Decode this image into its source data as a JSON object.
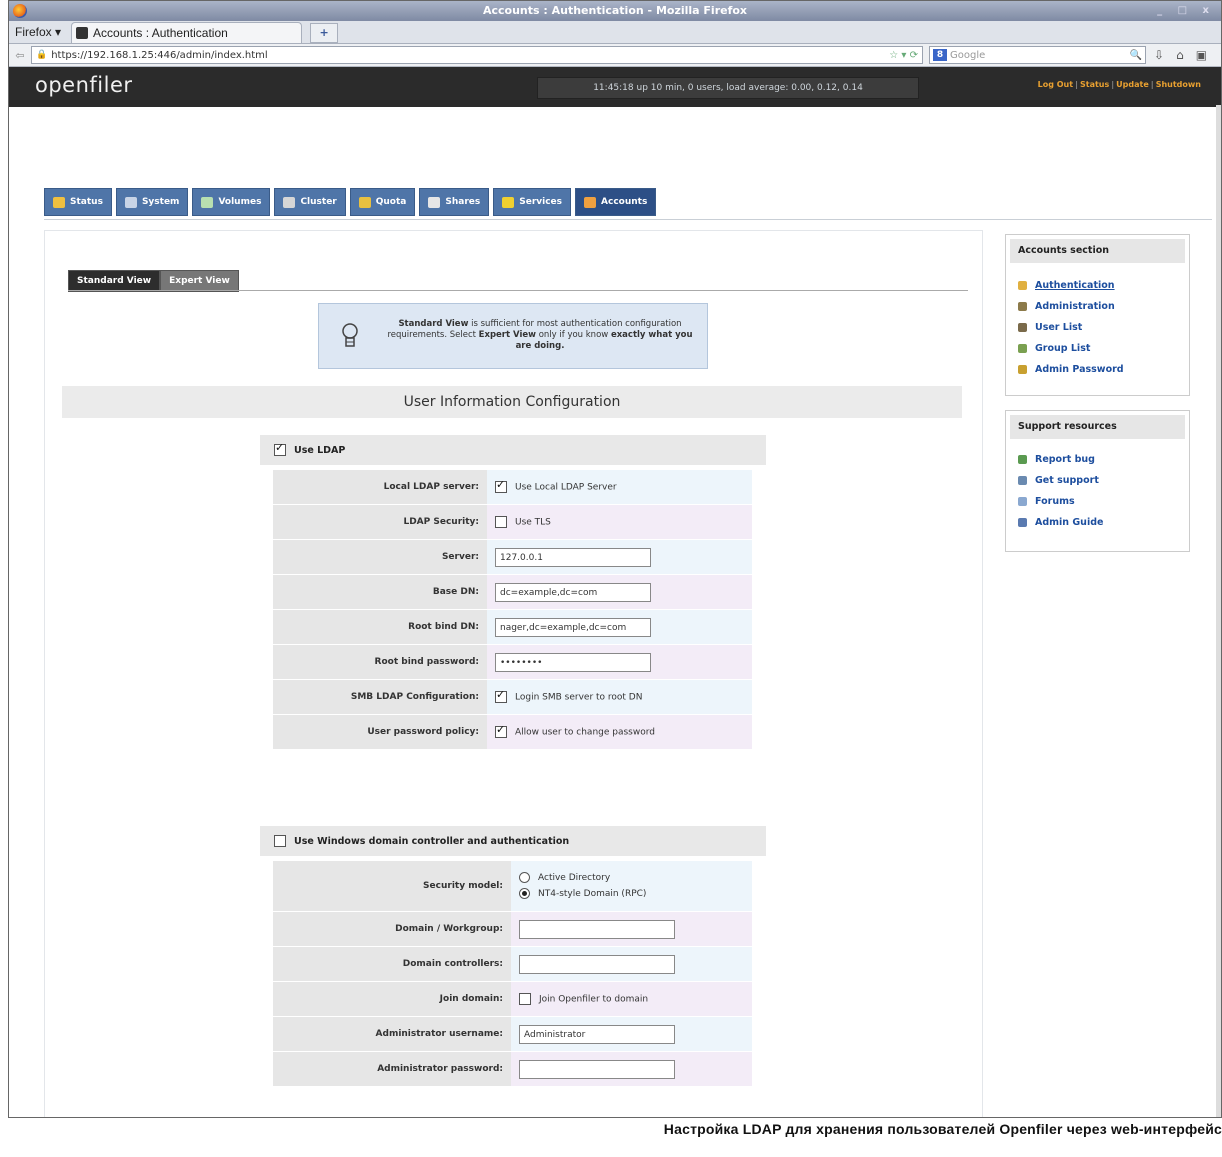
{
  "browser": {
    "window_title": "Accounts : Authentication - Mozilla Firefox",
    "menu_label": "Firefox",
    "tab_title": "Accounts : Authentication",
    "new_tab": "+",
    "url": "https://192.168.1.25:446/admin/index.html",
    "search_placeholder": "Google",
    "search_engine": "8",
    "window_buttons": "_ □ x"
  },
  "header": {
    "logo": "openfiler",
    "status_line": "11:45:18 up 10 min, 0 users, load average: 0.00, 0.12, 0.14",
    "links": [
      "Log Out",
      "Status",
      "Update",
      "Shutdown"
    ]
  },
  "nav_tabs": [
    {
      "label": "Status",
      "icon": "status-icon",
      "color": "#f0c040"
    },
    {
      "label": "System",
      "icon": "system-icon",
      "color": "#c8d4e6"
    },
    {
      "label": "Volumes",
      "icon": "volumes-icon",
      "color": "#b8e0b0"
    },
    {
      "label": "Cluster",
      "icon": "cluster-icon",
      "color": "#d6d6d6"
    },
    {
      "label": "Quota",
      "icon": "quota-icon",
      "color": "#e8c040"
    },
    {
      "label": "Shares",
      "icon": "shares-icon",
      "color": "#e6e6e6"
    },
    {
      "label": "Services",
      "icon": "services-icon",
      "color": "#f0d030"
    },
    {
      "label": "Accounts",
      "icon": "accounts-icon",
      "color": "#f0a040"
    }
  ],
  "view_tabs": {
    "standard": "Standard View",
    "expert": "Expert View"
  },
  "tip": {
    "bold1": "Standard View",
    "text1": " is sufficient for most authentication configuration requirements. Select ",
    "bold2": "Expert View",
    "text2": " only if you know ",
    "bold3": "exactly what you are doing."
  },
  "section_title": "User Information Configuration",
  "ldap": {
    "header": "Use LDAP",
    "checked": true,
    "rows": [
      {
        "label": "Local LDAP server:",
        "type": "checkbox",
        "checked": true,
        "text": "Use Local LDAP Server"
      },
      {
        "label": "LDAP Security:",
        "type": "checkbox",
        "checked": false,
        "text": "Use TLS"
      },
      {
        "label": "Server:",
        "type": "input",
        "value": "127.0.0.1"
      },
      {
        "label": "Base DN:",
        "type": "input",
        "value": "dc=example,dc=com"
      },
      {
        "label": "Root bind DN:",
        "type": "input",
        "value": "nager,dc=example,dc=com"
      },
      {
        "label": "Root bind password:",
        "type": "input",
        "value": "••••••••"
      },
      {
        "label": "SMB LDAP Configuration:",
        "type": "checkbox",
        "checked": true,
        "text": "Login SMB server to root DN"
      },
      {
        "label": "User password policy:",
        "type": "checkbox",
        "checked": true,
        "text": "Allow user to change password"
      }
    ]
  },
  "windows": {
    "header": "Use Windows domain controller and authentication",
    "checked": false,
    "security_model_label": "Security model:",
    "radio_options": [
      {
        "label": "Active Directory",
        "selected": false
      },
      {
        "label": "NT4-style Domain (RPC)",
        "selected": true
      }
    ],
    "rows": [
      {
        "label": "Domain / Workgroup:",
        "type": "input",
        "value": ""
      },
      {
        "label": "Domain controllers:",
        "type": "input",
        "value": ""
      },
      {
        "label": "Join domain:",
        "type": "checkbox",
        "checked": false,
        "text": "Join Openfiler to domain"
      },
      {
        "label": "Administrator username:",
        "type": "input",
        "value": "Administrator"
      },
      {
        "label": "Administrator password:",
        "type": "input",
        "value": ""
      }
    ]
  },
  "sidebar": {
    "accounts_title": "Accounts section",
    "accounts_items": [
      {
        "label": "Authentication",
        "icon": "authentication-icon",
        "color": "#e0b040"
      },
      {
        "label": "Administration",
        "icon": "administration-icon",
        "color": "#8c7a4a"
      },
      {
        "label": "User List",
        "icon": "user-list-icon",
        "color": "#7a6a4a"
      },
      {
        "label": "Group List",
        "icon": "group-list-icon",
        "color": "#7aa050"
      },
      {
        "label": "Admin Password",
        "icon": "admin-password-icon",
        "color": "#c8a030"
      }
    ],
    "support_title": "Support resources",
    "support_items": [
      {
        "label": "Report bug",
        "icon": "report-bug-icon",
        "color": "#5a9a50"
      },
      {
        "label": "Get support",
        "icon": "get-support-icon",
        "color": "#6a8ab0"
      },
      {
        "label": "Forums",
        "icon": "forums-icon",
        "color": "#8aa8d0"
      },
      {
        "label": "Admin Guide",
        "icon": "admin-guide-icon",
        "color": "#5a7ab0"
      }
    ]
  },
  "caption": "Настройка LDAP для хранения пользователей Openfiler через web-интерфейс"
}
